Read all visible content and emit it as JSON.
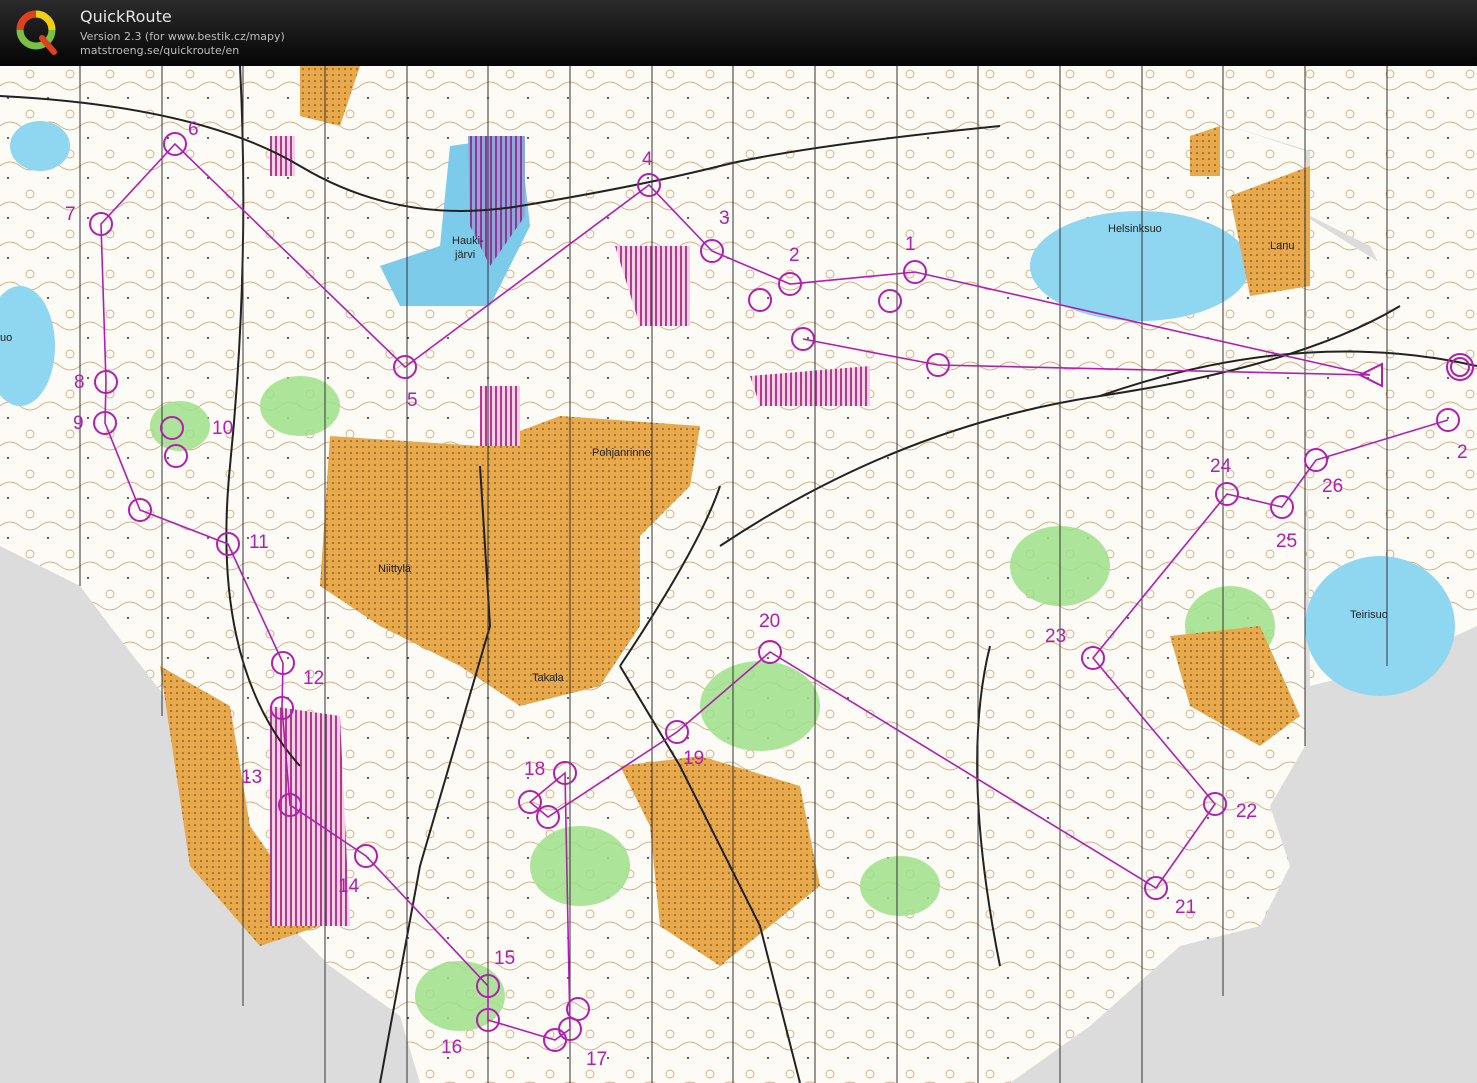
{
  "header": {
    "title": "QuickRoute",
    "version": "Version 2.3  (for www.bestik.cz/mapy)",
    "url": "matstroeng.se/quickroute/en"
  },
  "map": {
    "course_color": "#b01fb0",
    "place_names": [
      "Hauki-",
      "järvi",
      "Helsinksuo",
      "Lanu",
      "Pohjanrinne",
      "Niittylä",
      "Takala",
      "Teirisuo",
      "uo"
    ],
    "controls": [
      "1",
      "2",
      "3",
      "4",
      "5",
      "6",
      "7",
      "8",
      "9",
      "10",
      "11",
      "12",
      "13",
      "14",
      "15",
      "16",
      "17",
      "18",
      "19",
      "20",
      "21",
      "22",
      "23",
      "24",
      "25",
      "26",
      "2"
    ]
  }
}
